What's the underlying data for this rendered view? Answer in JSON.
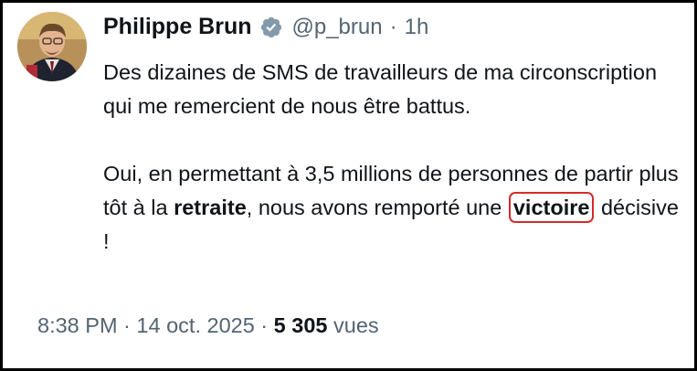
{
  "author": {
    "name": "Philippe Brun",
    "handle": "@p_brun",
    "separator": "·",
    "time_ago": "1h",
    "verified_icon": "verified-badge-icon"
  },
  "tweet": {
    "paragraph1": "Des dizaines de SMS de travailleurs de ma circonscription qui me remercient de nous être battus.",
    "p2_part1": "Oui, en permettant à 3,5 millions de personnes de partir plus tôt à la ",
    "p2_bold1": "retraite",
    "p2_part2": ", nous avons remporté une ",
    "p2_bold2": "victoire",
    "p2_part3": " décisive !"
  },
  "meta": {
    "time": "8:38 PM",
    "dot1": " · ",
    "date": "14 oct. 2025",
    "dot2": " · ",
    "views_count": "5 305",
    "views_label": " vues"
  },
  "colors": {
    "text": "#0f1419",
    "secondary": "#536471",
    "verified": "#829aab",
    "highlight_circle": "#d62b2b"
  }
}
